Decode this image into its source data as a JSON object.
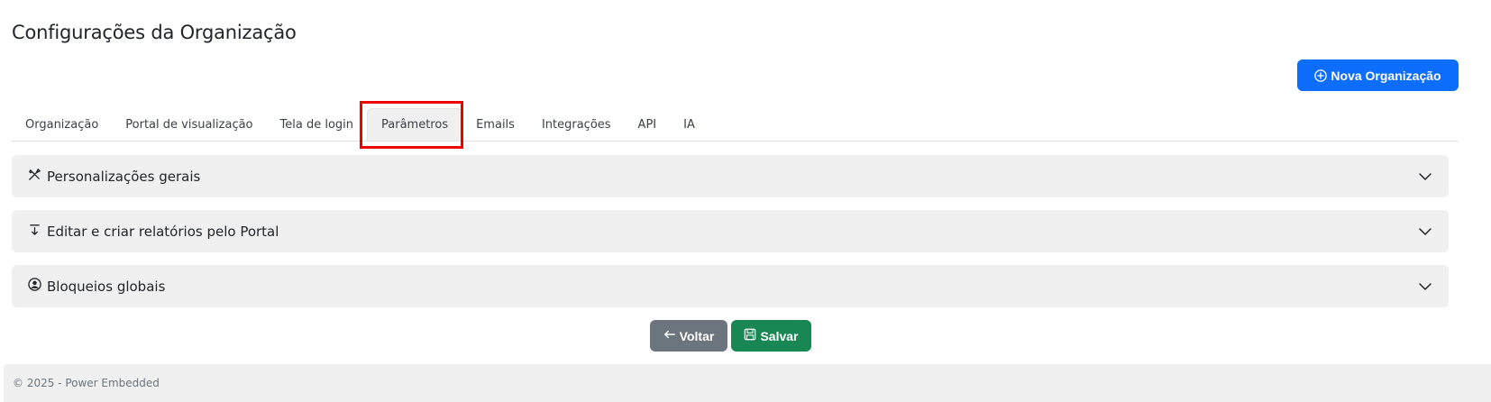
{
  "page": {
    "title": "Configurações da Organização"
  },
  "header": {
    "new_org_label": "Nova Organização"
  },
  "tabs": [
    {
      "label": "Organização",
      "active": false
    },
    {
      "label": "Portal de visualização",
      "active": false
    },
    {
      "label": "Tela de login",
      "active": false
    },
    {
      "label": "Parâmetros",
      "active": true
    },
    {
      "label": "Emails",
      "active": false
    },
    {
      "label": "Integrações",
      "active": false
    },
    {
      "label": "API",
      "active": false
    },
    {
      "label": "IA",
      "active": false
    }
  ],
  "sections": [
    {
      "label": "Personalizações gerais",
      "icon": "tools-icon"
    },
    {
      "label": "Editar e criar relatórios pelo Portal",
      "icon": "arrow-down-bar-icon"
    },
    {
      "label": "Bloqueios globais",
      "icon": "person-circle-icon"
    }
  ],
  "actions": {
    "back_label": "Voltar",
    "save_label": "Salvar"
  },
  "footer": {
    "text": "© 2025 - Power Embedded"
  },
  "colors": {
    "primary": "#0d6efd",
    "secondary": "#6c757d",
    "success": "#198754",
    "highlight": "#ee0000",
    "panel": "#f0f0f0"
  }
}
